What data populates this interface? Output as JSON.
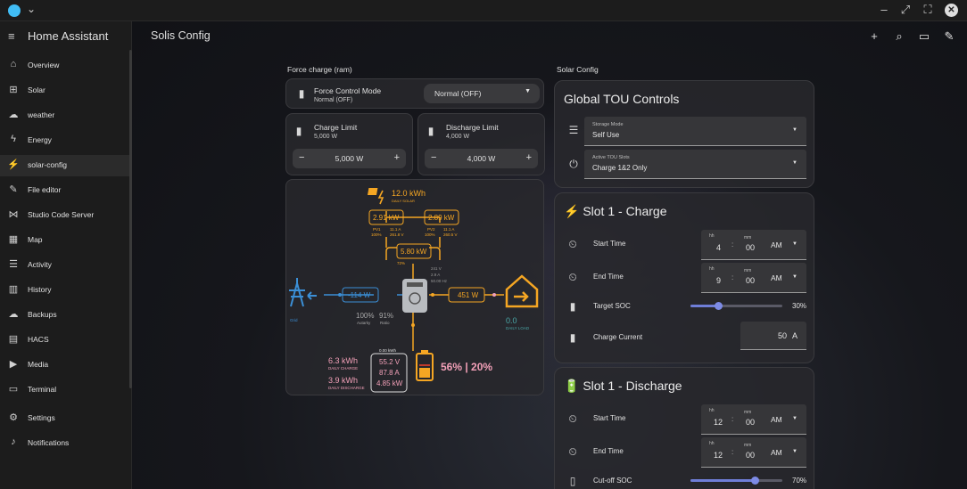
{
  "window": {
    "chevron": "⌄",
    "controls": [
      "–",
      "⤢",
      "⛶"
    ],
    "close": "✕"
  },
  "sidebar": {
    "title": "Home Assistant",
    "items": [
      {
        "label": "Overview",
        "icon": "home-icon",
        "glyph": "⌂"
      },
      {
        "label": "Solar",
        "icon": "solar-panel-icon",
        "glyph": "⊞"
      },
      {
        "label": "weather",
        "icon": "weather-icon",
        "glyph": "☁"
      },
      {
        "label": "Energy",
        "icon": "lightning-icon",
        "glyph": "ϟ"
      },
      {
        "label": "solar-config",
        "icon": "solar-config-icon",
        "glyph": "⚡"
      },
      {
        "label": "File editor",
        "icon": "wrench-icon",
        "glyph": "✎"
      },
      {
        "label": "Studio Code Server",
        "icon": "vscode-icon",
        "glyph": "⋈"
      },
      {
        "label": "Map",
        "icon": "map-icon",
        "glyph": "▦"
      },
      {
        "label": "Activity",
        "icon": "activity-icon",
        "glyph": "☰"
      },
      {
        "label": "History",
        "icon": "history-icon",
        "glyph": "▥"
      },
      {
        "label": "Backups",
        "icon": "backup-icon",
        "glyph": "☁"
      },
      {
        "label": "HACS",
        "icon": "hacs-icon",
        "glyph": "▤"
      },
      {
        "label": "Media",
        "icon": "media-icon",
        "glyph": "▶"
      },
      {
        "label": "Terminal",
        "icon": "terminal-icon",
        "glyph": "▭"
      },
      {
        "label": "Settings",
        "icon": "gear-icon",
        "glyph": "⚙"
      },
      {
        "label": "Notifications",
        "icon": "bell-icon",
        "glyph": "♪"
      }
    ],
    "active_index": 4
  },
  "header": {
    "title": "Solis Config"
  },
  "left_section": {
    "title": "Force charge (ram)",
    "force_control": {
      "title": "Force Control Mode",
      "state": "Normal (OFF)",
      "select_value": "Normal (OFF)"
    },
    "charge_limit": {
      "title": "Charge Limit",
      "state": "5,000 W",
      "value": "5,000 W"
    },
    "discharge_limit": {
      "title": "Discharge Limit",
      "state": "4,000 W",
      "value": "4,000 W"
    }
  },
  "flow": {
    "solar_total": "12.0 kWh",
    "solar_label": "DAILY SOLAR",
    "pv1_power": "2.91 kW",
    "pv2_power": "2.89 kW",
    "pv1_label": "PV1",
    "pv1_pct": "100%",
    "pv1_amps": "11.1 A",
    "pv1_volts": "261.8 V",
    "pv2_label": "PV2",
    "pv2_pct": "100%",
    "pv2_amps": "11.1 A",
    "pv2_volts": "260.5 V",
    "pv_total": "5.80 kW",
    "pv_total_pct": "72%",
    "inverter_volts": "241 V",
    "inverter_amps": "2.9 A",
    "inverter_freq": "50.00 Hz",
    "grid_power": "-114 W",
    "grid_label": "Grid",
    "autarky_value": "100%",
    "autarky_label": "Autarky",
    "ratio_value": "91%",
    "ratio_label": "Ratio",
    "load_power": "451 W",
    "daily_load_value": "0.0",
    "daily_load_label": "DAILY LOAD",
    "daily_charge_value": "6.3 kWh",
    "daily_charge_label": "DAILY CHARGE",
    "daily_discharge_value": "3.9 kWh",
    "daily_discharge_label": "DAILY DISCHARGE",
    "battery_top": "0.00 kWh",
    "battery_volts": "55.2 V",
    "battery_amps": "87.8 A",
    "battery_power": "4.85 kW",
    "battery_soc": "56% | 20%",
    "colors": {
      "solar": "#f5a623",
      "grid": "#3b8fd6",
      "load": "#f5a623",
      "battery": "#f5a623",
      "battery_text": "#f3a0b8",
      "daily_text": "#f3a0b8"
    }
  },
  "right_section": {
    "title": "Solar Config",
    "global": {
      "heading": "Global TOU Controls",
      "storage_mode": {
        "label": "Storage Mode",
        "value": "Self Use"
      },
      "active_slots": {
        "label": "Active TOU Slots",
        "value": "Charge 1&2 Only"
      }
    },
    "slot_charge": {
      "heading": "⚡ Slot 1 - Charge",
      "start": {
        "label": "Start Time",
        "hh": "4",
        "mm": "00",
        "ampm": "AM"
      },
      "end": {
        "label": "End Time",
        "hh": "9",
        "mm": "00",
        "ampm": "AM"
      },
      "target_soc": {
        "label": "Target SOC",
        "value": "30%",
        "fraction": 0.3
      },
      "charge_current": {
        "label": "Charge Current",
        "value": "50",
        "unit": "A"
      }
    },
    "slot_discharge": {
      "heading": "🔋 Slot 1 - Discharge",
      "start": {
        "label": "Start Time",
        "hh": "12",
        "mm": "00",
        "ampm": "AM"
      },
      "end": {
        "label": "End Time",
        "hh": "12",
        "mm": "00",
        "ampm": "AM"
      },
      "cutoff_soc": {
        "label": "Cut-off SOC",
        "value": "70%",
        "fraction": 0.7
      }
    },
    "time_labels": {
      "hh": "hh",
      "mm": "mm",
      "colon": ":"
    }
  }
}
